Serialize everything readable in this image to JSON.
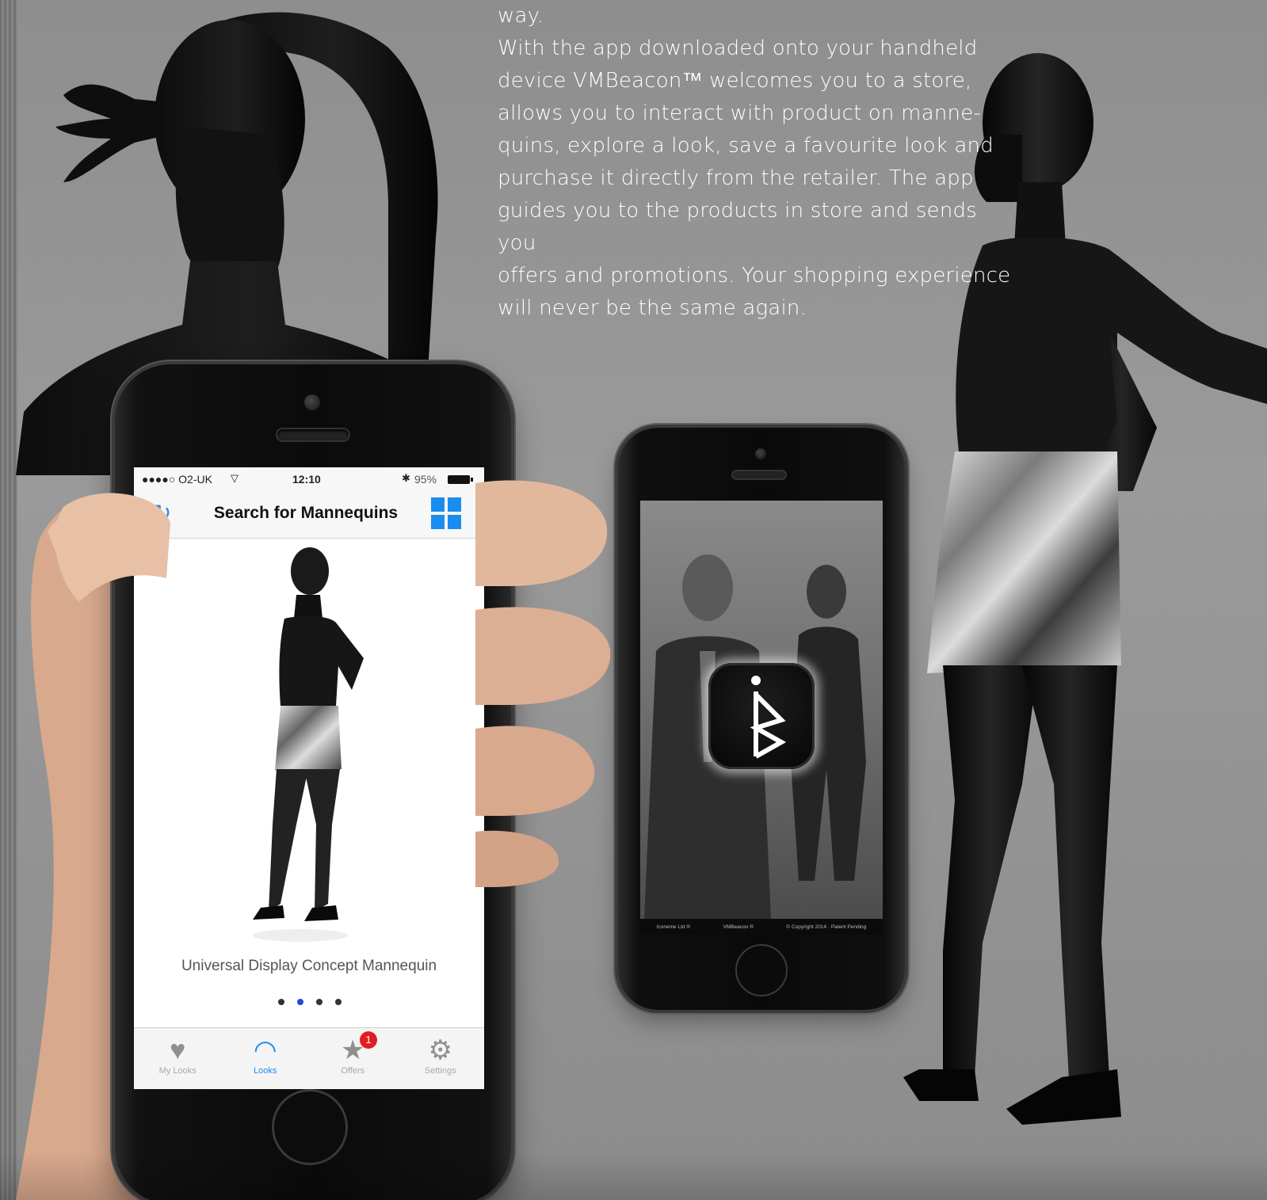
{
  "intro": {
    "lines": [
      "way.",
      "With the app downloaded onto your handheld",
      "device VMBeacon™ welcomes you to a store,",
      "allows you to interact with product on manne-",
      "quins, explore a look, save a favourite look and",
      "purchase it directly from the retailer.  The app",
      "guides you to the products in store and sends you",
      "offers and promotions.  Your shopping experience",
      "will never be the same again."
    ]
  },
  "phone_main": {
    "status": {
      "carrier": "●●●●○ O2-UK",
      "wifi_icon": "wifi-icon",
      "time": "12:10",
      "bluetooth_icon": "bluetooth-icon",
      "battery": "95%"
    },
    "nav": {
      "refresh_icon": "refresh-icon",
      "title": "Search for Mannequins",
      "grid_icon": "grid-view-icon"
    },
    "product": {
      "title": "Universal Display Concept Mannequin"
    },
    "pager": {
      "count": 4,
      "active_index": 1
    },
    "tabs": [
      {
        "label": "My Looks",
        "icon": "heart-icon",
        "active": false
      },
      {
        "label": "Looks",
        "icon": "wifi-icon",
        "active": true
      },
      {
        "label": "Offers",
        "icon": "star-icon",
        "active": false,
        "badge": "1"
      },
      {
        "label": "Settings",
        "icon": "gear-icon",
        "active": false
      }
    ]
  },
  "phone_secondary": {
    "app_icon": "vmbeacon-logo-icon",
    "footer": [
      "Iconeme Ltd ®",
      "VMBeacon ®",
      "© Copyright 2014 · Patent Pending"
    ]
  },
  "colors": {
    "background": "#909090",
    "accent_blue": "#1a8cf0",
    "badge_red": "#e02020"
  }
}
